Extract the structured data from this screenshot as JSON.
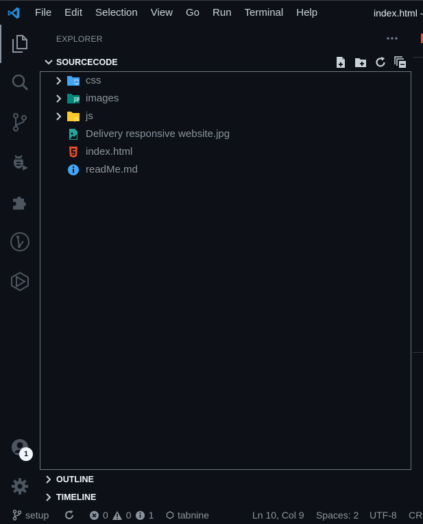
{
  "titlebar": {
    "menu": [
      "File",
      "Edit",
      "Selection",
      "View",
      "Go",
      "Run",
      "Terminal",
      "Help"
    ],
    "window_title": "index.html -"
  },
  "activitybar": {
    "items": [
      "explorer-icon",
      "search-icon",
      "source-control-icon",
      "run-debug-icon",
      "extensions-icon",
      "git-graph-icon",
      "live-share-icon"
    ],
    "accounts_badge": "1",
    "manage": "gear-icon"
  },
  "sidebar": {
    "title": "EXPLORER",
    "more_actions": "...",
    "folder": {
      "name": "SOURCECODE",
      "actions": [
        "new-file-icon",
        "new-folder-icon",
        "refresh-icon",
        "collapse-all-icon"
      ]
    },
    "tree": [
      {
        "name": "css",
        "type": "folder",
        "icon": "folder-css-icon",
        "color": "#42a5f5"
      },
      {
        "name": "images",
        "type": "folder",
        "icon": "folder-images-icon",
        "color": "#26a69a"
      },
      {
        "name": "js",
        "type": "folder",
        "icon": "folder-js-icon",
        "color": "#ffca28"
      },
      {
        "name": "Delivery responsive website.jpg",
        "type": "file",
        "icon": "image-file-icon",
        "color": "#26a69a"
      },
      {
        "name": "index.html",
        "type": "file",
        "icon": "html5-icon",
        "color": "#e44d26"
      },
      {
        "name": "readMe.md",
        "type": "file",
        "icon": "info-icon",
        "color": "#42a5f5"
      }
    ],
    "outline": "OUTLINE",
    "timeline": "TIMELINE"
  },
  "statusbar": {
    "branch": "setup",
    "errors": "0",
    "warnings": "0",
    "infos": "1",
    "tabnine": "tabnine",
    "position": "Ln 10, Col 9",
    "spaces": "Spaces: 2",
    "encoding": "UTF-8",
    "eol": "CRLF"
  }
}
